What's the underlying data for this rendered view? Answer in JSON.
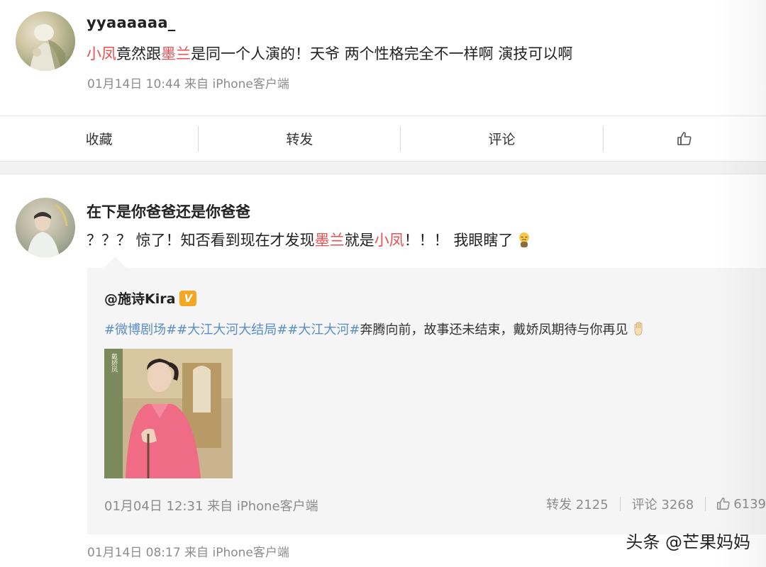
{
  "post1": {
    "username": "yyaaaaaa_",
    "content_parts": [
      "小凤",
      "竟然跟",
      "墨兰",
      "是同一个人演的！天爷 两个性格完全不一样啊 演技可以啊"
    ],
    "meta": "01月14日 10:44 来自 iPhone客户端"
  },
  "actions": {
    "collect": "收藏",
    "repost": "转发",
    "comment": "评论",
    "like_icon": "thumbs-up-icon"
  },
  "post2": {
    "username": "在下是你爸爸还是你爸爸",
    "content_parts": [
      "？？？ 惊了！知否看到现在才发现",
      "墨兰",
      "就是",
      "小凤",
      "！！！ 我眼瞎了"
    ],
    "emoji": "blind-emoji-icon",
    "meta": "01月14日 08:17 来自 iPhone客户端"
  },
  "quoted": {
    "author": "@施诗Kira",
    "verified_badge": "V",
    "tags": [
      "#微博剧场#",
      "#大江大河大结局#",
      "#大江大河#"
    ],
    "text": "奔腾向前，故事还未结束，戴娇凤期待与你再见",
    "wave_emoji": "wave-hand-icon",
    "image_caption": "戴娇凤",
    "meta": "01月04日 12:31 来自 iPhone客户端",
    "stats": {
      "repost": "转发 2125",
      "comment": "评论 3268",
      "like": "6139"
    }
  },
  "watermark": "头条 @芒果妈妈",
  "colors": {
    "highlight_red": "#eb4f4f",
    "tag_blue": "#5b8ec5",
    "meta_gray": "#8c8c8c",
    "quote_bg": "#f5f5f5",
    "verified_orange": "#f5a623"
  }
}
